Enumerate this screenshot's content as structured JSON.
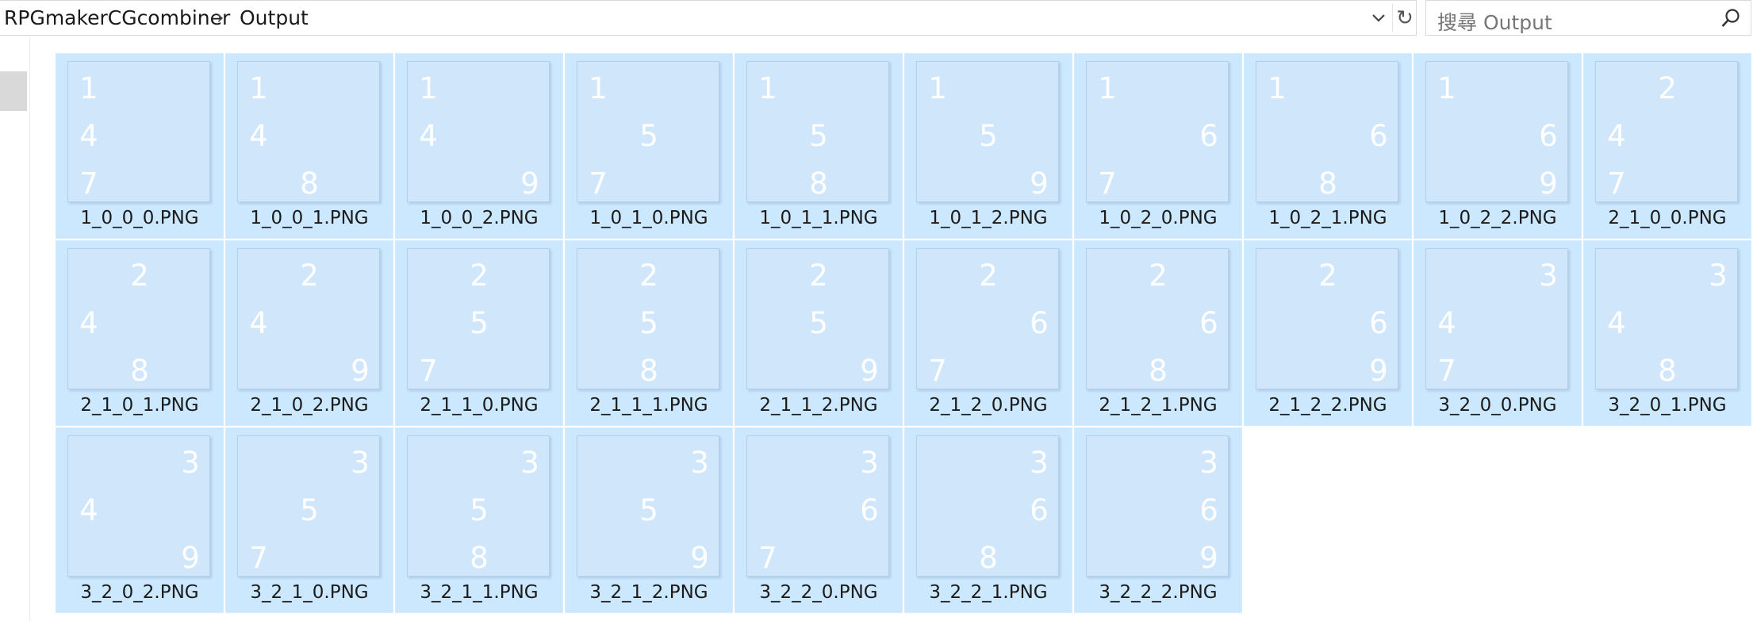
{
  "breadcrumb": {
    "root": "RPGmakerCGcombiner",
    "separator": "›",
    "current": "Output"
  },
  "address_dropdown_icon": "chevron-down-icon",
  "refresh_icon": "↻",
  "search": {
    "placeholder": "搜尋 Output",
    "icon": "search-icon"
  },
  "colors": {
    "selection_bg": "#cce8ff",
    "thumb_bg": "#cfe6fb",
    "digit": "#ffffff"
  },
  "files": [
    {
      "name": "1_0_0_0.PNG",
      "top": "1",
      "mid": "4",
      "bot": "7"
    },
    {
      "name": "1_0_0_1.PNG",
      "top": "1",
      "mid": "4",
      "bot": "8"
    },
    {
      "name": "1_0_0_2.PNG",
      "top": "1",
      "mid": "4",
      "bot": "9"
    },
    {
      "name": "1_0_1_0.PNG",
      "top": "1",
      "mid": "5",
      "bot": "7"
    },
    {
      "name": "1_0_1_1.PNG",
      "top": "1",
      "mid": "5",
      "bot": "8"
    },
    {
      "name": "1_0_1_2.PNG",
      "top": "1",
      "mid": "5",
      "bot": "9"
    },
    {
      "name": "1_0_2_0.PNG",
      "top": "1",
      "mid": "6",
      "bot": "7"
    },
    {
      "name": "1_0_2_1.PNG",
      "top": "1",
      "mid": "6",
      "bot": "8"
    },
    {
      "name": "1_0_2_2.PNG",
      "top": "1",
      "mid": "6",
      "bot": "9"
    },
    {
      "name": "2_1_0_0.PNG",
      "top": "2",
      "mid": "4",
      "bot": "7"
    },
    {
      "name": "2_1_0_1.PNG",
      "top": "2",
      "mid": "4",
      "bot": "8"
    },
    {
      "name": "2_1_0_2.PNG",
      "top": "2",
      "mid": "4",
      "bot": "9"
    },
    {
      "name": "2_1_1_0.PNG",
      "top": "2",
      "mid": "5",
      "bot": "7"
    },
    {
      "name": "2_1_1_1.PNG",
      "top": "2",
      "mid": "5",
      "bot": "8"
    },
    {
      "name": "2_1_1_2.PNG",
      "top": "2",
      "mid": "5",
      "bot": "9"
    },
    {
      "name": "2_1_2_0.PNG",
      "top": "2",
      "mid": "6",
      "bot": "7"
    },
    {
      "name": "2_1_2_1.PNG",
      "top": "2",
      "mid": "6",
      "bot": "8"
    },
    {
      "name": "2_1_2_2.PNG",
      "top": "2",
      "mid": "6",
      "bot": "9"
    },
    {
      "name": "3_2_0_0.PNG",
      "top": "3",
      "mid": "4",
      "bot": "7"
    },
    {
      "name": "3_2_0_1.PNG",
      "top": "3",
      "mid": "4",
      "bot": "8"
    },
    {
      "name": "3_2_0_2.PNG",
      "top": "3",
      "mid": "4",
      "bot": "9"
    },
    {
      "name": "3_2_1_0.PNG",
      "top": "3",
      "mid": "5",
      "bot": "7"
    },
    {
      "name": "3_2_1_1.PNG",
      "top": "3",
      "mid": "5",
      "bot": "8"
    },
    {
      "name": "3_2_1_2.PNG",
      "top": "3",
      "mid": "5",
      "bot": "9"
    },
    {
      "name": "3_2_2_0.PNG",
      "top": "3",
      "mid": "6",
      "bot": "7"
    },
    {
      "name": "3_2_2_1.PNG",
      "top": "3",
      "mid": "6",
      "bot": "8"
    },
    {
      "name": "3_2_2_2.PNG",
      "top": "3",
      "mid": "6",
      "bot": "9"
    }
  ]
}
